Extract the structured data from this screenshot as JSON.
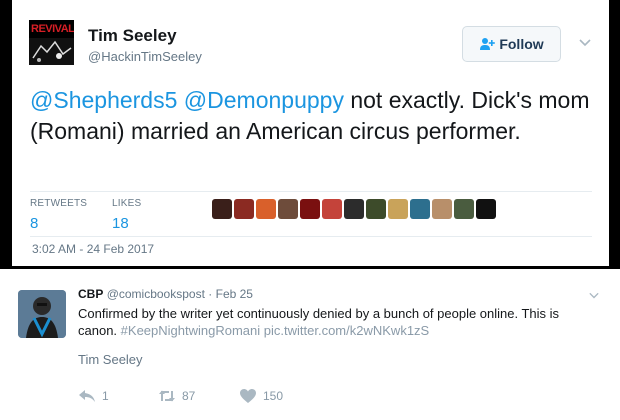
{
  "main_tweet": {
    "avatar_text": "REVIVAL",
    "display_name": "Tim Seeley",
    "handle": "@HackinTimSeeley",
    "follow_label": "Follow",
    "mention_1": "@Shepherds5",
    "mention_2": "@Demonpuppy",
    "text_1": "not exactly.",
    "text_2": "Dick's mom (Romani) married an American circus performer.",
    "retweets_label": "RETWEETS",
    "retweets_count": "8",
    "likes_label": "LIKES",
    "likes_count": "18",
    "timestamp": "3:02 AM - 24 Feb 2017",
    "liker_colors": [
      "#3a1f1a",
      "#8b2a22",
      "#d9602b",
      "#6e4c3b",
      "#7a1010",
      "#c4433a",
      "#2c2c2c",
      "#3d4b2a",
      "#c9a35a",
      "#2d6f8e",
      "#b88f6a",
      "#4a5c3f",
      "#111111"
    ]
  },
  "quoted_tweet": {
    "display_name": "CBP",
    "handle": "@comicbookspost",
    "separator": "·",
    "date": "Feb 25",
    "text": "Confirmed by the writer yet continuously denied by a bunch of people online. This is canon.",
    "hashtag": "#KeepNightwingRomani",
    "pic_link": "pic.twitter.com/k2wNKwk1zS",
    "author_line": "Tim Seeley",
    "reply_count": "1",
    "retweet_count": "87",
    "like_count": "150"
  }
}
